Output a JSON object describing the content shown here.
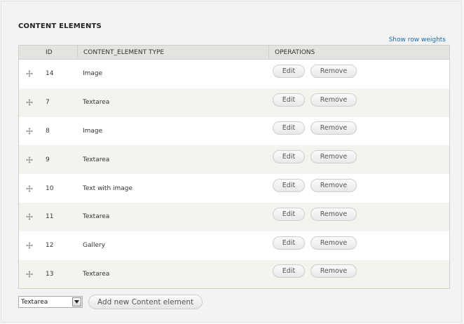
{
  "section": {
    "title": "CONTENT ELEMENTS",
    "row_weights_link": "Show row weights"
  },
  "table": {
    "headers": {
      "id": "ID",
      "type": "CONTENT_ELEMENT TYPE",
      "operations": "OPERATIONS"
    },
    "rows": [
      {
        "id": "14",
        "type": "Image"
      },
      {
        "id": "7",
        "type": "Textarea"
      },
      {
        "id": "8",
        "type": "Image"
      },
      {
        "id": "9",
        "type": "Textarea"
      },
      {
        "id": "10",
        "type": "Text with image"
      },
      {
        "id": "11",
        "type": "Textarea"
      },
      {
        "id": "12",
        "type": "Gallery"
      },
      {
        "id": "13",
        "type": "Textarea"
      }
    ],
    "edit_label": "Edit",
    "remove_label": "Remove"
  },
  "footer": {
    "select_value": "Textarea",
    "add_button_label": "Add new Content element"
  },
  "icons": {
    "drag": "drag-handle-icon",
    "dropdown": "chevron-down-icon"
  }
}
